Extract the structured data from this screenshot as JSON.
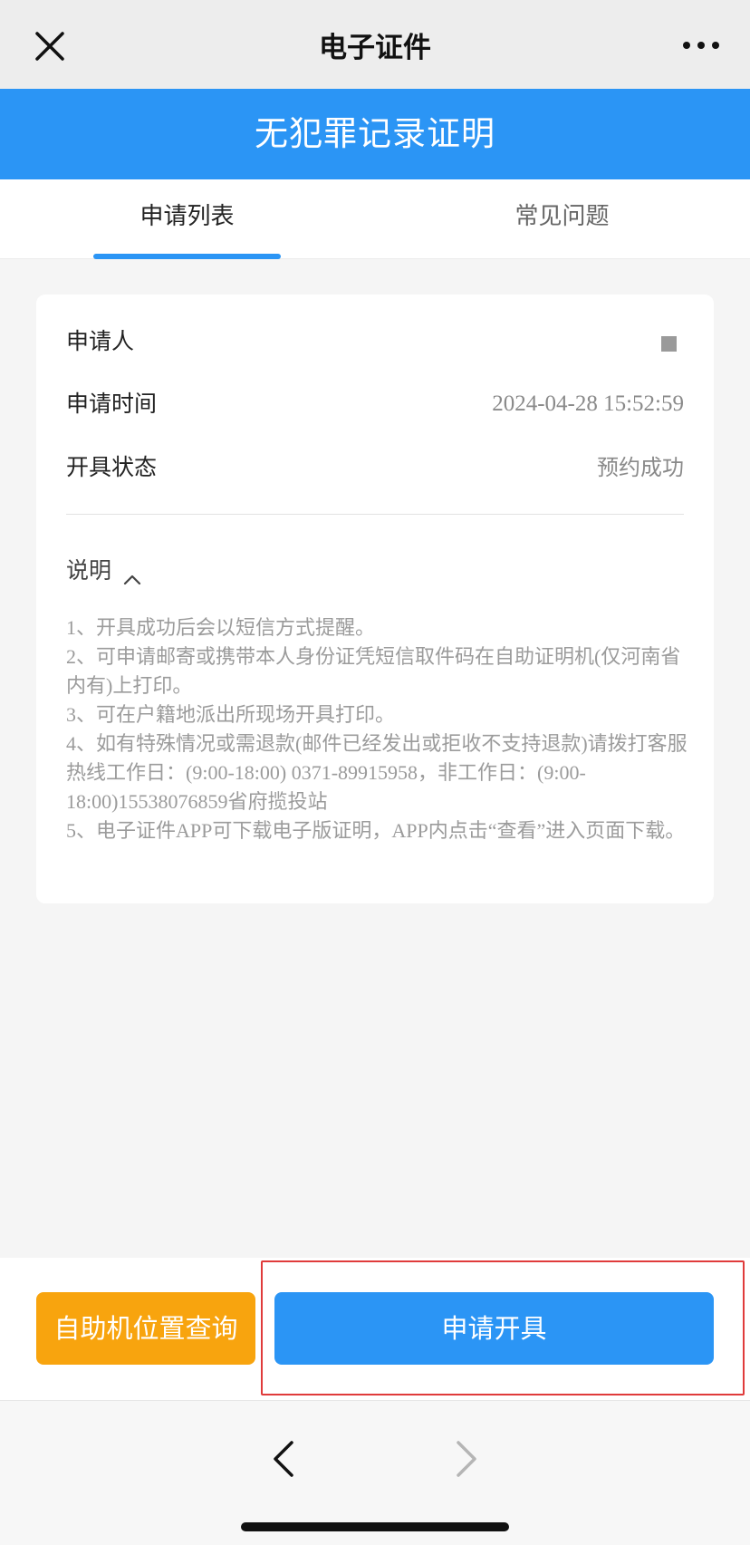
{
  "topbar": {
    "title": "电子证件",
    "close_icon": "close-icon",
    "more_icon": "more-icon"
  },
  "banner": {
    "title": "无犯罪记录证明",
    "color": "#2b95f5"
  },
  "tabs": [
    {
      "label": "申请列表",
      "active": true
    },
    {
      "label": "常见问题",
      "active": false
    }
  ],
  "record": {
    "applicant_label": "申请人",
    "applicant_value_icon": "masked-square",
    "time_label": "申请时间",
    "time_value": "2024-04-28 15:52:59",
    "status_label": "开具状态",
    "status_value": "预约成功"
  },
  "explain": {
    "label": "说明",
    "expanded": true,
    "notes": [
      "1、开具成功后会以短信方式提醒。",
      "2、可申请邮寄或携带本人身份证凭短信取件码在自助证明机(仅河南省内有)上打印。",
      "3、可在户籍地派出所现场开具打印。",
      "4、如有特殊情况或需退款(邮件已经发出或拒收不支持退款)请拨打客服热线工作日：(9:00-18:00) 0371-89915958，非工作日：(9:00-18:00)15538076859省府揽投站",
      "5、电子证件APP可下载电子版证明，APP内点击“查看”进入页面下载。"
    ]
  },
  "actions": {
    "kiosk_label": "自助机位置查询",
    "kiosk_color": "#f8a40e",
    "apply_label": "申请开具",
    "apply_color": "#2b95f5",
    "highlight_color": "#e03b3b"
  },
  "navbar": {
    "back_icon": "chevron-left-icon",
    "forward_icon": "chevron-right-icon"
  }
}
